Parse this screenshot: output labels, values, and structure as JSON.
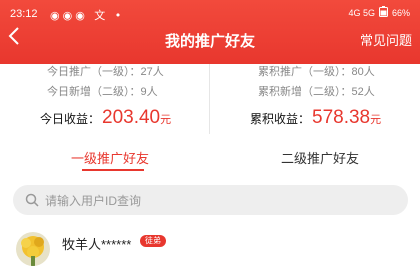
{
  "status_bar": {
    "time": "23:12",
    "app_icons": "◉◉◉ 文 •",
    "network_text": "4G 5G",
    "battery": "66%"
  },
  "header": {
    "back_icon": "chevron-left-icon",
    "title": "我的推广好友",
    "faq": "常见问题"
  },
  "stats": {
    "left": {
      "line1": "今日推广（一级）：27人",
      "line2": "今日新增（二级）：9人",
      "earn_label": "今日收益：",
      "earn_value": "203.40",
      "earn_unit": "元"
    },
    "right": {
      "line1": "累积推广（一级）：80人",
      "line2": "累积新增（二级）：52人",
      "earn_label": "累积收益：",
      "earn_value": "578.38",
      "earn_unit": "元"
    }
  },
  "tabs": [
    {
      "label": "一级推广好友",
      "active": true
    },
    {
      "label": "二级推广好友",
      "active": false
    }
  ],
  "search": {
    "placeholder": "请输入用户ID查询",
    "value": ""
  },
  "friends": [
    {
      "name": "牧羊人******",
      "badge": "徒弟"
    }
  ],
  "colors": {
    "accent": "#e8372e",
    "header_top": "#f24a3c"
  }
}
